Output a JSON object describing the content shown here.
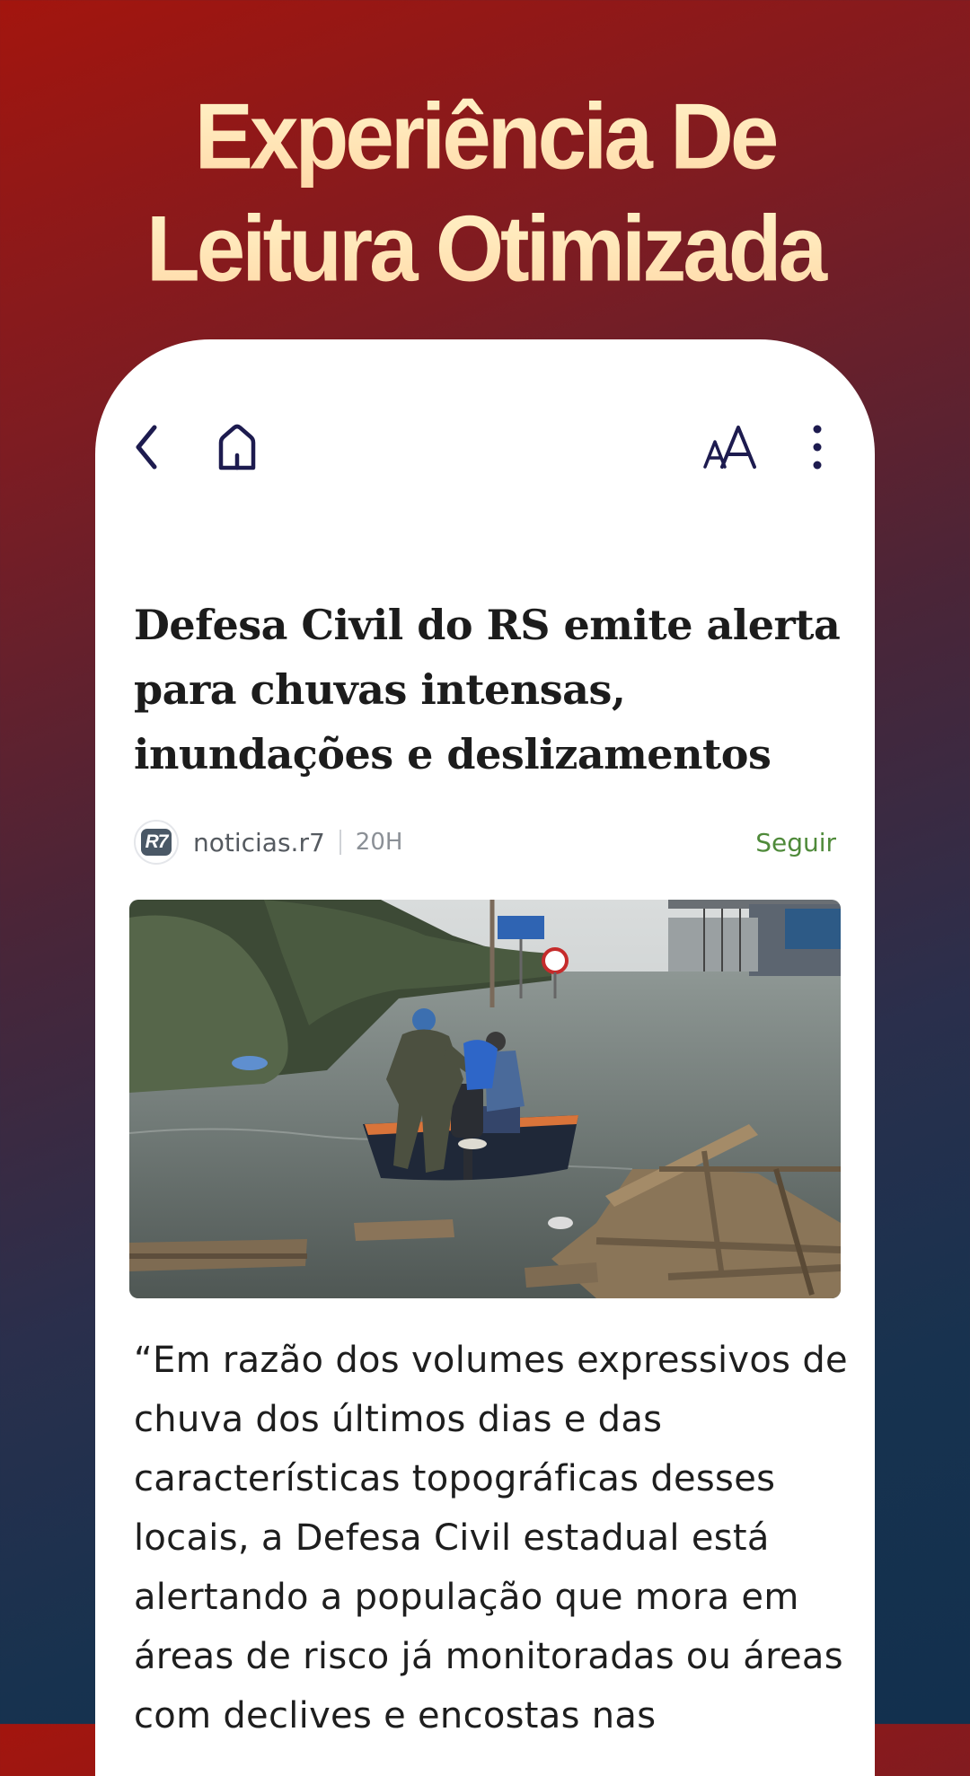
{
  "promo": {
    "title_line1": "Experiência De",
    "title_line2": "Leitura Otimizada"
  },
  "toolbar": {
    "back_icon": "chevron-left-icon",
    "home_icon": "home-icon",
    "font_size_icon": "font-size-icon",
    "more_icon": "more-vertical-icon"
  },
  "article": {
    "headline": "Defesa Civil do RS emite alerta para chuvas intensas, inundações e deslizamentos",
    "source_logo_text": "R7",
    "source_name": "noticias.r7",
    "time": "20H",
    "follow_label": "Seguir",
    "body": "“Em razão dos volumes expressivos de chuva dos últimos dias e das características topográficas desses locais, a Defesa Civil estadual está alertando a população que mora em áreas de risco já monitoradas ou áreas com declives e encostas nas"
  },
  "colors": {
    "accent_follow": "#4f8a3a",
    "icon_color": "#1d1b4f",
    "title_gradient_top": "#fff4c9",
    "title_gradient_bottom": "#ffd9a8"
  }
}
